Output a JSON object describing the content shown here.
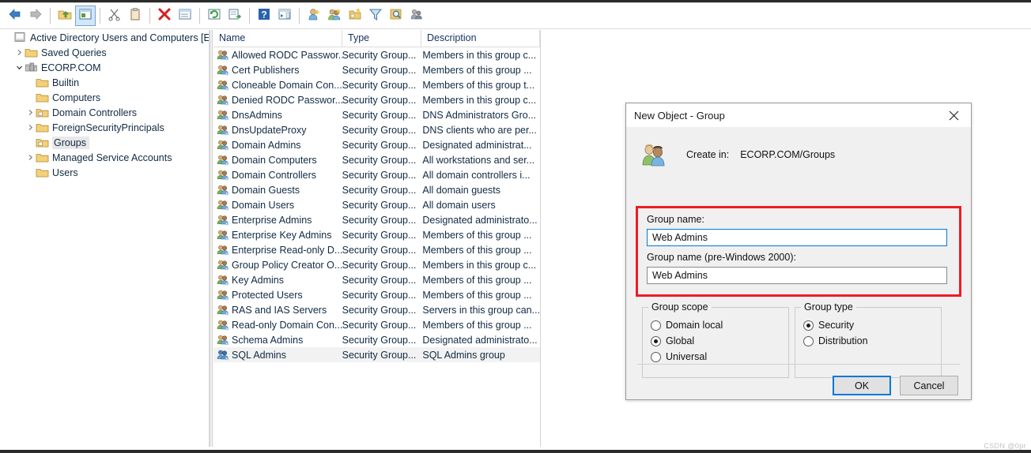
{
  "toolbar": {
    "buttons": [
      {
        "name": "back-button",
        "icon": "arrow-left-icon",
        "active": false
      },
      {
        "name": "forward-button",
        "icon": "arrow-right-icon",
        "active": false
      },
      {
        "name": "up-one-level-button",
        "icon": "folder-up-icon",
        "active": false
      },
      {
        "name": "show-hide-console-tree-button",
        "icon": "console-tree-icon",
        "active": true
      },
      {
        "name": "cut-button",
        "icon": "scissors-icon",
        "active": false
      },
      {
        "name": "paste-button",
        "icon": "clipboard-icon",
        "active": false
      },
      {
        "name": "delete-button",
        "icon": "red-x-icon",
        "active": false
      },
      {
        "name": "properties-button",
        "icon": "properties-icon",
        "active": false
      },
      {
        "name": "refresh-button",
        "icon": "refresh-icon",
        "active": false
      },
      {
        "name": "export-list-button",
        "icon": "export-list-icon",
        "active": false
      },
      {
        "name": "help-button",
        "icon": "question-mark-icon",
        "active": false
      },
      {
        "name": "show-hide-action-pane-button",
        "icon": "action-pane-icon",
        "active": false
      },
      {
        "name": "new-user-button",
        "icon": "new-user-icon",
        "active": false
      },
      {
        "name": "new-group-button",
        "icon": "new-group-icon",
        "active": false
      },
      {
        "name": "new-container-button",
        "icon": "new-container-icon",
        "active": false
      },
      {
        "name": "filter-button",
        "icon": "funnel-icon",
        "active": false
      },
      {
        "name": "find-button",
        "icon": "magnifier-icon",
        "active": false
      },
      {
        "name": "query-button",
        "icon": "query-tool-icon",
        "active": false
      }
    ]
  },
  "tree": {
    "items": [
      {
        "label": "Active Directory Users and Computers [E-RDC",
        "icon": "console-root-icon",
        "indent": 0,
        "chevron": "none",
        "selected": false
      },
      {
        "label": "Saved Queries",
        "icon": "folder-icon",
        "indent": 1,
        "chevron": "collapsed",
        "selected": false
      },
      {
        "label": "ECORP.COM",
        "icon": "domain-icon",
        "indent": 1,
        "chevron": "expanded",
        "selected": false
      },
      {
        "label": "Builtin",
        "icon": "folder-icon",
        "indent": 2,
        "chevron": "none",
        "selected": false
      },
      {
        "label": "Computers",
        "icon": "folder-icon",
        "indent": 2,
        "chevron": "none",
        "selected": false
      },
      {
        "label": "Domain Controllers",
        "icon": "ou-icon",
        "indent": 2,
        "chevron": "collapsed",
        "selected": false
      },
      {
        "label": "ForeignSecurityPrincipals",
        "icon": "folder-icon",
        "indent": 2,
        "chevron": "collapsed",
        "selected": false
      },
      {
        "label": "Groups",
        "icon": "ou-icon",
        "indent": 2,
        "chevron": "none",
        "selected": true
      },
      {
        "label": "Managed Service Accounts",
        "icon": "folder-icon",
        "indent": 2,
        "chevron": "collapsed",
        "selected": false
      },
      {
        "label": "Users",
        "icon": "folder-icon",
        "indent": 2,
        "chevron": "none",
        "selected": false
      }
    ]
  },
  "list": {
    "columns": [
      "Name",
      "Type",
      "Description"
    ],
    "rows": [
      {
        "name": "Allowed RODC Passwor...",
        "type": "Security Group...",
        "description": "Members in this group c...",
        "icon": "group-icon",
        "selected": false
      },
      {
        "name": "Cert Publishers",
        "type": "Security Group...",
        "description": "Members of this group ...",
        "icon": "group-icon",
        "selected": false
      },
      {
        "name": "Cloneable Domain Con...",
        "type": "Security Group...",
        "description": "Members of this group t...",
        "icon": "group-icon",
        "selected": false
      },
      {
        "name": "Denied RODC Passwor...",
        "type": "Security Group...",
        "description": "Members in this group c...",
        "icon": "group-icon",
        "selected": false
      },
      {
        "name": "DnsAdmins",
        "type": "Security Group...",
        "description": "DNS Administrators Gro...",
        "icon": "group-icon",
        "selected": false
      },
      {
        "name": "DnsUpdateProxy",
        "type": "Security Group...",
        "description": "DNS clients who are per...",
        "icon": "group-icon",
        "selected": false
      },
      {
        "name": "Domain Admins",
        "type": "Security Group...",
        "description": "Designated administrat...",
        "icon": "group-icon",
        "selected": false
      },
      {
        "name": "Domain Computers",
        "type": "Security Group...",
        "description": "All workstations and ser...",
        "icon": "group-icon",
        "selected": false
      },
      {
        "name": "Domain Controllers",
        "type": "Security Group...",
        "description": "All domain controllers i...",
        "icon": "group-icon",
        "selected": false
      },
      {
        "name": "Domain Guests",
        "type": "Security Group...",
        "description": "All domain guests",
        "icon": "group-icon",
        "selected": false
      },
      {
        "name": "Domain Users",
        "type": "Security Group...",
        "description": "All domain users",
        "icon": "group-icon",
        "selected": false
      },
      {
        "name": "Enterprise Admins",
        "type": "Security Group...",
        "description": "Designated administrato...",
        "icon": "group-icon",
        "selected": false
      },
      {
        "name": "Enterprise Key Admins",
        "type": "Security Group...",
        "description": "Members of this group ...",
        "icon": "group-icon",
        "selected": false
      },
      {
        "name": "Enterprise Read-only D...",
        "type": "Security Group...",
        "description": "Members of this group ...",
        "icon": "group-icon",
        "selected": false
      },
      {
        "name": "Group Policy Creator O...",
        "type": "Security Group...",
        "description": "Members in this group c...",
        "icon": "group-icon",
        "selected": false
      },
      {
        "name": "Key Admins",
        "type": "Security Group...",
        "description": "Members of this group ...",
        "icon": "group-icon",
        "selected": false
      },
      {
        "name": "Protected Users",
        "type": "Security Group...",
        "description": "Members of this group ...",
        "icon": "group-icon",
        "selected": false
      },
      {
        "name": "RAS and IAS Servers",
        "type": "Security Group...",
        "description": "Servers in this group can...",
        "icon": "group-icon",
        "selected": false
      },
      {
        "name": "Read-only Domain Con...",
        "type": "Security Group...",
        "description": "Members of this group ...",
        "icon": "group-icon",
        "selected": false
      },
      {
        "name": "Schema Admins",
        "type": "Security Group...",
        "description": "Designated administrato...",
        "icon": "group-icon",
        "selected": false
      },
      {
        "name": "SQL Admins",
        "type": "Security Group...",
        "description": "SQL Admins group",
        "icon": "group-blue-icon",
        "selected": true
      }
    ]
  },
  "dialog": {
    "title": "New Object - Group",
    "close_icon": "close-icon",
    "create_in_label": "Create in:",
    "create_in_value": "ECORP.COM/Groups",
    "group_name_label": "Group name:",
    "group_name_value": "Web Admins",
    "group_name_pre2000_label": "Group name (pre-Windows 2000):",
    "group_name_pre2000_value": "Web Admins",
    "scope": {
      "legend": "Group scope",
      "options": [
        {
          "label": "Domain local",
          "selected": false
        },
        {
          "label": "Global",
          "selected": true
        },
        {
          "label": "Universal",
          "selected": false
        }
      ]
    },
    "type": {
      "legend": "Group type",
      "options": [
        {
          "label": "Security",
          "selected": true
        },
        {
          "label": "Distribution",
          "selected": false
        }
      ]
    },
    "ok_label": "OK",
    "cancel_label": "Cancel",
    "highlight_color": "#ee1c24",
    "focus_color": "#0078d7"
  },
  "watermark": "CSDN @0pr"
}
